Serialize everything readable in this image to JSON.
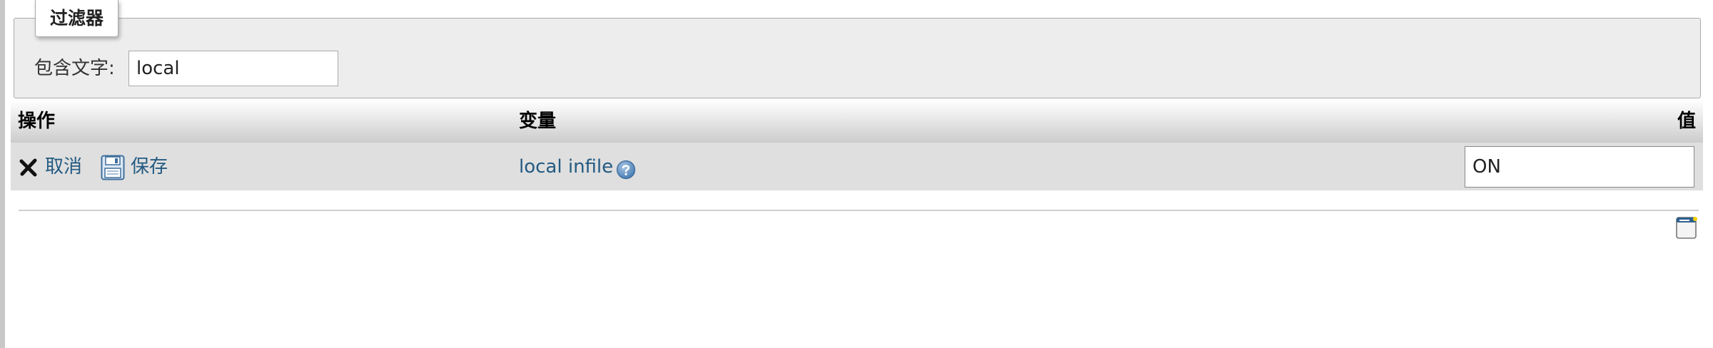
{
  "filter": {
    "legend": "过滤器",
    "label": "包含文字:",
    "value": "local"
  },
  "table": {
    "headers": {
      "action": "操作",
      "variable": "变量",
      "value": "值"
    },
    "rows": [
      {
        "cancel_label": "取消",
        "save_label": "保存",
        "variable": "local infile",
        "value": "ON"
      }
    ]
  },
  "icons": {
    "cancel": "close-x-icon",
    "save": "floppy-disk-icon",
    "help": "help-question-icon",
    "panel": "window-panel-icon"
  },
  "colors": {
    "link": "#235a81",
    "filter_bg": "#ededed",
    "row_bg": "#dfdfdf"
  }
}
